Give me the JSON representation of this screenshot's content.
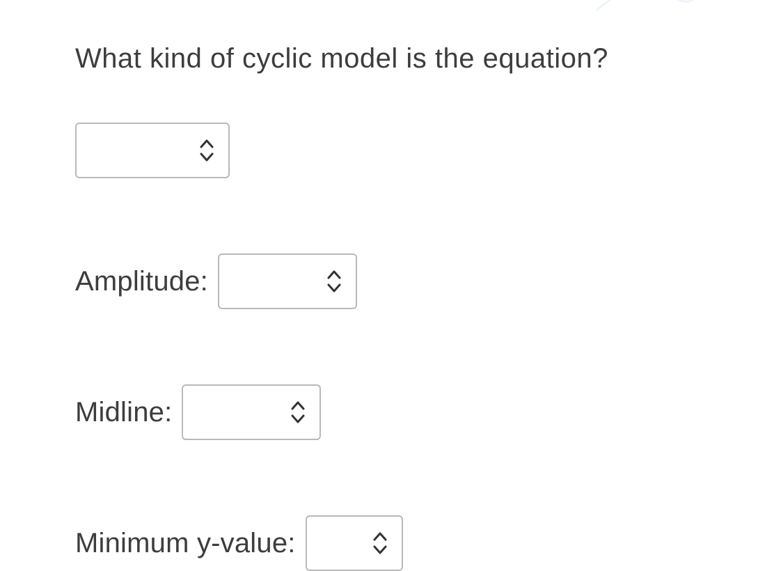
{
  "question": "What kind of cyclic model is the equation?",
  "fields": {
    "model": {
      "value": ""
    },
    "amplitude": {
      "label": "Amplitude:",
      "value": ""
    },
    "midline": {
      "label": "Midline:",
      "value": ""
    },
    "min_y": {
      "label": "Minimum y-value:",
      "value": ""
    }
  }
}
